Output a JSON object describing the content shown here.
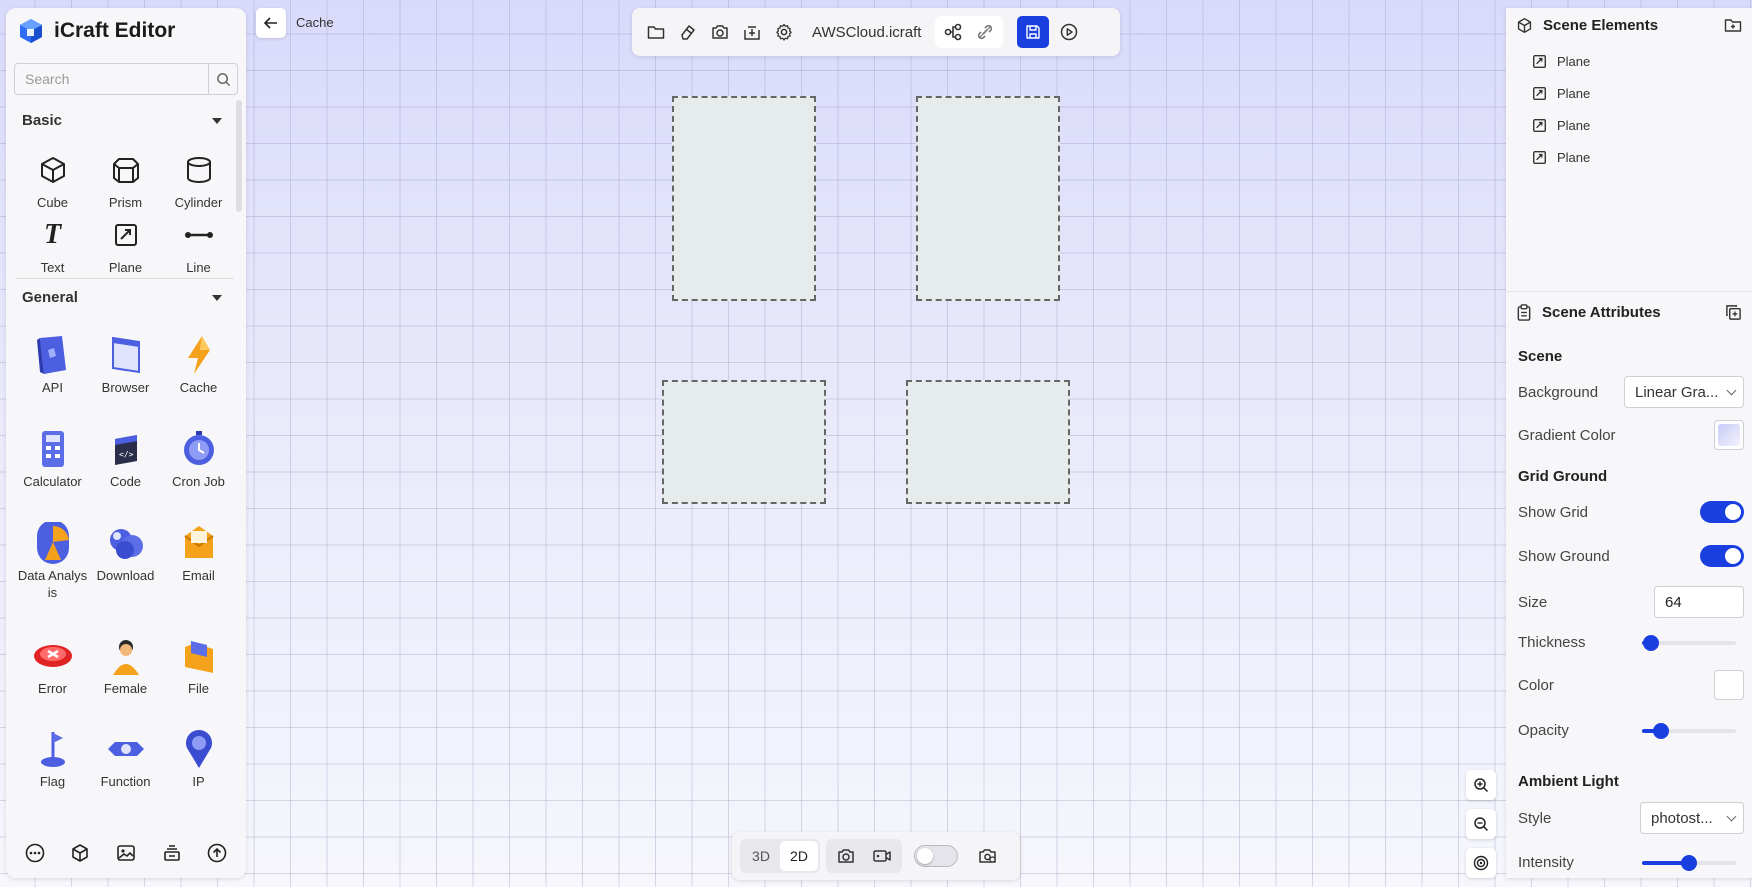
{
  "app": {
    "title": "iCraft Editor"
  },
  "breadcrumb": {
    "label": "Cache"
  },
  "search": {
    "placeholder": "Search"
  },
  "sections": {
    "basic": {
      "title": "Basic",
      "items": [
        {
          "label": "Cube",
          "icon": "cube-icon"
        },
        {
          "label": "Prism",
          "icon": "prism-icon"
        },
        {
          "label": "Cylinder",
          "icon": "cylinder-icon"
        },
        {
          "label": "Text",
          "icon": "text-icon"
        },
        {
          "label": "Plane",
          "icon": "plane-icon"
        },
        {
          "label": "Line",
          "icon": "line-icon"
        }
      ]
    },
    "general": {
      "title": "General",
      "items": [
        {
          "label": "API",
          "icon": "api-icon"
        },
        {
          "label": "Browser",
          "icon": "browser-icon"
        },
        {
          "label": "Cache",
          "icon": "cache-icon"
        },
        {
          "label": "Calculator",
          "icon": "calculator-icon"
        },
        {
          "label": "Code",
          "icon": "code-icon"
        },
        {
          "label": "Cron Job",
          "icon": "cron-job-icon"
        },
        {
          "label": "Data Analysis",
          "icon": "data-analysis-icon"
        },
        {
          "label": "Download",
          "icon": "download-icon"
        },
        {
          "label": "Email",
          "icon": "email-icon"
        },
        {
          "label": "Error",
          "icon": "error-icon"
        },
        {
          "label": "Female",
          "icon": "female-icon"
        },
        {
          "label": "File",
          "icon": "file-icon"
        },
        {
          "label": "Flag",
          "icon": "flag-icon"
        },
        {
          "label": "Function",
          "icon": "function-icon"
        },
        {
          "label": "IP",
          "icon": "ip-icon"
        }
      ]
    }
  },
  "toolbar": {
    "file_name": "AWSCloud.icraft"
  },
  "scene_elements": {
    "title": "Scene Elements",
    "items": [
      {
        "label": "Plane"
      },
      {
        "label": "Plane"
      },
      {
        "label": "Plane"
      },
      {
        "label": "Plane"
      }
    ]
  },
  "scene_attributes": {
    "title": "Scene Attributes",
    "scene_heading": "Scene",
    "background_label": "Background",
    "background_value": "Linear Gra...",
    "gradient_color_label": "Gradient Color",
    "grid_ground_heading": "Grid Ground",
    "show_grid_label": "Show Grid",
    "show_grid": true,
    "show_ground_label": "Show Ground",
    "show_ground": true,
    "size_label": "Size",
    "size_value": "64",
    "thickness_label": "Thickness",
    "thickness": 0.1,
    "color_label": "Color",
    "opacity_label": "Opacity",
    "opacity": 0.2,
    "ambient_light_heading": "Ambient Light",
    "style_label": "Style",
    "style_value": "photost...",
    "intensity_label": "Intensity",
    "intensity": 0.5
  },
  "bottom_toolbar": {
    "view_3d": "3D",
    "view_2d": "2D",
    "active_view": "2D"
  },
  "colors": {
    "accent": "#1a3fe0",
    "plane_fill": "#e6ebec"
  }
}
